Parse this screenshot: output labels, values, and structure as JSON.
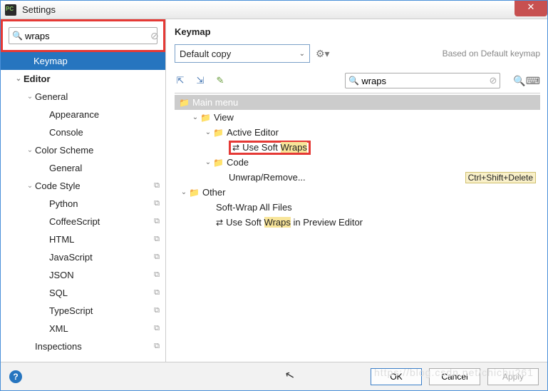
{
  "window": {
    "title": "Settings"
  },
  "sidebar": {
    "search": "wraps",
    "items": [
      {
        "label": "Keymap",
        "level": 1,
        "selected": true
      },
      {
        "label": "Editor",
        "level": 1,
        "chev": "v",
        "bold": true
      },
      {
        "label": "General",
        "level": 2,
        "chev": "v"
      },
      {
        "label": "Appearance",
        "level": 3
      },
      {
        "label": "Console",
        "level": 3
      },
      {
        "label": "Color Scheme",
        "level": 2,
        "chev": "v"
      },
      {
        "label": "General",
        "level": 3
      },
      {
        "label": "Code Style",
        "level": 2,
        "chev": "v",
        "copy": true
      },
      {
        "label": "Python",
        "level": 3,
        "copy": true
      },
      {
        "label": "CoffeeScript",
        "level": 3,
        "copy": true
      },
      {
        "label": "HTML",
        "level": 3,
        "copy": true
      },
      {
        "label": "JavaScript",
        "level": 3,
        "copy": true
      },
      {
        "label": "JSON",
        "level": 3,
        "copy": true
      },
      {
        "label": "SQL",
        "level": 3,
        "copy": true
      },
      {
        "label": "TypeScript",
        "level": 3,
        "copy": true
      },
      {
        "label": "XML",
        "level": 3,
        "copy": true
      },
      {
        "label": "Inspections",
        "level": 2,
        "copy": true
      }
    ]
  },
  "keymap": {
    "title": "Keymap",
    "profile": "Default copy",
    "based_on": "Based on Default keymap",
    "filter": "wraps",
    "rows": [
      {
        "type": "header",
        "level": 1,
        "text": "Main menu"
      },
      {
        "type": "folder",
        "level": 2,
        "chev": "v",
        "text": "View"
      },
      {
        "type": "folder",
        "level": 3,
        "chev": "v",
        "text": "Active Editor"
      },
      {
        "type": "action-hl",
        "level": 5,
        "pre": "Use Soft ",
        "hl": "Wraps",
        "post": "",
        "redbox": true
      },
      {
        "type": "folder",
        "level": 3,
        "chev": "v",
        "text": "Code"
      },
      {
        "type": "action",
        "level": 5,
        "text": "Unwrap/Remove...",
        "shortcut": "Ctrl+Shift+Delete"
      },
      {
        "type": "folder",
        "level": 1,
        "chev": "v",
        "text": "Other"
      },
      {
        "type": "action",
        "level": 4,
        "text": "Soft-Wrap All Files"
      },
      {
        "type": "action-hl",
        "level": 4,
        "pre": "Use Soft ",
        "hl": "Wraps",
        "post": " in Preview Editor",
        "icon": true
      }
    ]
  },
  "footer": {
    "ok": "OK",
    "cancel": "Cancel",
    "apply": "Apply"
  },
  "watermark": "https://blog.csdn.net/chichu261"
}
